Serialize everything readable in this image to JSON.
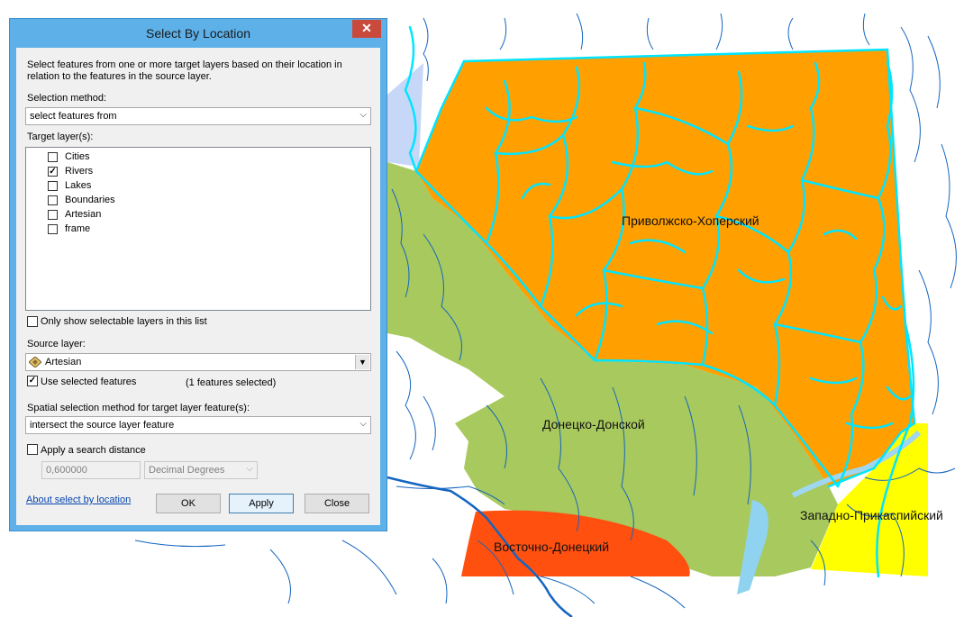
{
  "map": {
    "regions": [
      {
        "label": "Приволжско-Хоперский",
        "color": "#ff9f00"
      },
      {
        "label": "Донецко-Донской",
        "color": "#a8c95d"
      },
      {
        "label": "Восточно-Донецкий",
        "color": "#ff5010"
      },
      {
        "label": "Западно-Прикаспийский",
        "color": "#ffff00"
      }
    ],
    "river_color": "#00e5ff",
    "stream_color": "#1565c0"
  },
  "dialog": {
    "title": "Select By Location",
    "close_icon": "close-icon",
    "description": "Select features from one or more target layers based on their location in relation to the features in the source layer.",
    "selection_method_label": "Selection method:",
    "selection_method_value": "select features from",
    "target_layers_label": "Target layer(s):",
    "target_layers": [
      {
        "name": "Cities",
        "checked": false
      },
      {
        "name": "Rivers",
        "checked": true
      },
      {
        "name": "Lakes",
        "checked": false
      },
      {
        "name": "Boundaries",
        "checked": false
      },
      {
        "name": "Artesian",
        "checked": false
      },
      {
        "name": "frame",
        "checked": false
      }
    ],
    "only_selectable_label": "Only show selectable layers in this list",
    "source_layer_label": "Source layer:",
    "source_layer_value": "Artesian",
    "use_selected_label": "Use selected features",
    "features_selected": "(1 features selected)",
    "spatial_method_label": "Spatial selection method for target layer feature(s):",
    "spatial_method_value": "intersect the source layer feature",
    "search_distance_label": "Apply a search distance",
    "search_distance_value": "0,600000",
    "search_distance_units": "Decimal Degrees",
    "about_link": "About select by location",
    "ok_label": "OK",
    "apply_label": "Apply",
    "close_label": "Close"
  }
}
